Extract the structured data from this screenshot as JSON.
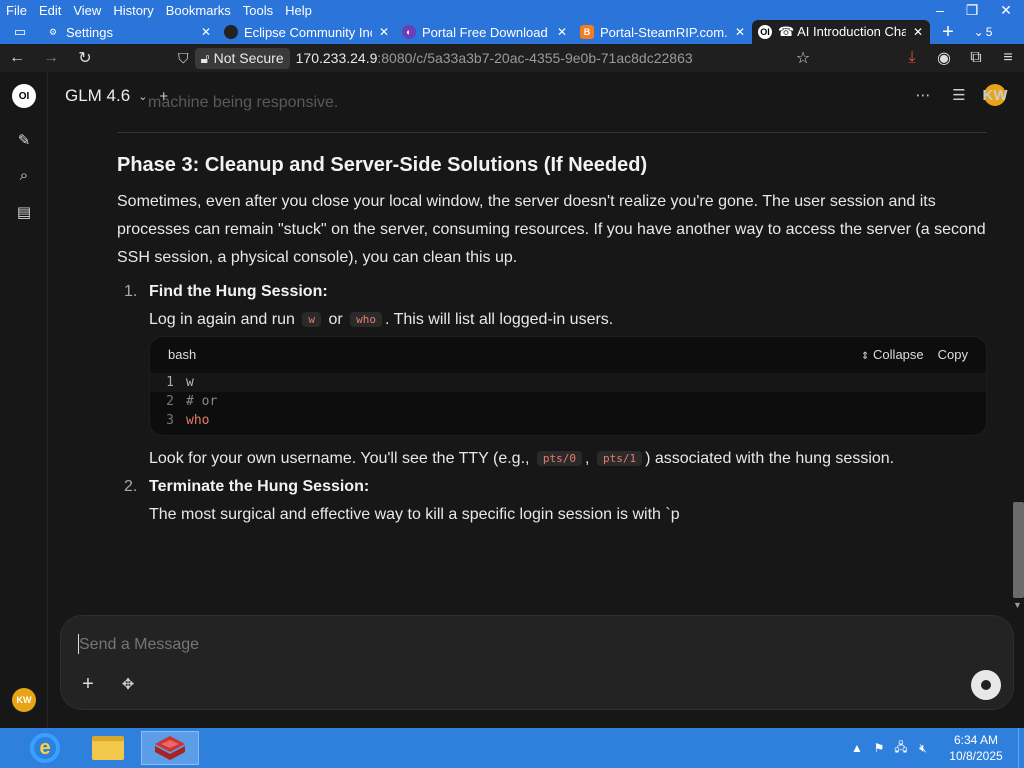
{
  "browser": {
    "menu": [
      {
        "key": "F",
        "rest": "ile"
      },
      {
        "key": "E",
        "rest": "dit"
      },
      {
        "key": "V",
        "rest": "iew"
      },
      {
        "key": "H",
        "rest": "istory",
        "first": ""
      },
      {
        "key": "B",
        "rest": "ookmarks"
      },
      {
        "key": "T",
        "rest": "ools"
      },
      {
        "key": "H",
        "rest": "elp"
      }
    ],
    "menu_labels": [
      "File",
      "Edit",
      "View",
      "History",
      "Bookmarks",
      "Tools",
      "Help"
    ],
    "tabs": [
      {
        "title": "Settings",
        "icon": "gear-icon",
        "active": false
      },
      {
        "title": "Eclipse Community Inc",
        "icon": "eclipse-icon",
        "active": false
      },
      {
        "title": "Portal Free Download (",
        "icon": "portal-icon",
        "active": false
      },
      {
        "title": "Portal-SteamRIP.com.r",
        "icon": "blogger-icon",
        "active": false
      },
      {
        "title": "☎ AI Introduction Cha",
        "icon": "openwebui-icon",
        "active": true
      }
    ],
    "tab_count": "5",
    "not_secure_label": "Not Secure",
    "url_host": "170.233.24.9",
    "url_rest": ":8080/c/5a33a3b7-20ac-4355-9e0b-71ac8dc22863",
    "colors": {
      "chrome_blue": "#2b74d9",
      "toolbar": "#1f1f1f",
      "download_accent": "#e0533a"
    }
  },
  "app": {
    "model_name": "GLM 4.6",
    "avatar_initials": "KW",
    "avatar_color": "#e8a317"
  },
  "message": {
    "cut_text": "machine being responsive.",
    "phase_title": "Phase 3: Cleanup and Server-Side Solutions (If Needed)",
    "paragraph": "Sometimes, even after you close your local window, the server doesn't realize you're gone. The user session and its processes can remain \"stuck\" on the server, consuming resources. If you have another way to access the server (a second SSH session, a physical console), you can clean this up.",
    "step1": {
      "num": "1.",
      "heading": "Find the Hung Session:",
      "text_a": "Log in again and run",
      "code_a": "w",
      "text_b": "or",
      "code_b": "who",
      "text_c": ". This will list all logged-in users."
    },
    "codeblock": {
      "lang": "bash",
      "collapse_label": "Collapse",
      "copy_label": "Copy",
      "lines": [
        {
          "num": "1",
          "code": "w"
        },
        {
          "num": "2",
          "code": "# or"
        },
        {
          "num": "3",
          "code": "who"
        }
      ]
    },
    "step1_after": {
      "text_a": "Look for your own username. You'll see the TTY (e.g.,",
      "code_a": "pts/0",
      "text_b": ",",
      "code_b": "pts/1",
      "text_c": ") associated with the hung session."
    },
    "step2": {
      "num": "2.",
      "heading": "Terminate the Hung Session:",
      "text": "The most surgical and effective way to kill a specific login session is with `p"
    }
  },
  "composer": {
    "placeholder": "Send a Message"
  },
  "taskbar": {
    "time": "6:34 AM",
    "date": "10/8/2025"
  }
}
